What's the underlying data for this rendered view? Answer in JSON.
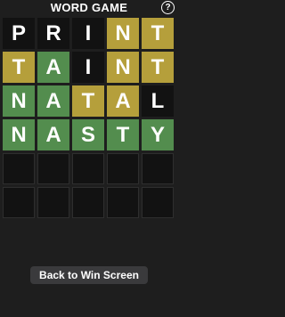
{
  "header": {
    "title": "WORD GAME",
    "help_label": "?"
  },
  "colors": {
    "background": "#1e1e1e",
    "absent": "#121212",
    "present": "#b59f3b",
    "correct": "#538d4e",
    "button": "#3a3a3c"
  },
  "board": {
    "rows": [
      {
        "tiles": [
          {
            "letter": "P",
            "state": "absent"
          },
          {
            "letter": "R",
            "state": "absent"
          },
          {
            "letter": "I",
            "state": "absent"
          },
          {
            "letter": "N",
            "state": "present"
          },
          {
            "letter": "T",
            "state": "present"
          }
        ]
      },
      {
        "tiles": [
          {
            "letter": "T",
            "state": "present"
          },
          {
            "letter": "A",
            "state": "correct"
          },
          {
            "letter": "I",
            "state": "absent"
          },
          {
            "letter": "N",
            "state": "present"
          },
          {
            "letter": "T",
            "state": "present"
          }
        ]
      },
      {
        "tiles": [
          {
            "letter": "N",
            "state": "correct"
          },
          {
            "letter": "A",
            "state": "correct"
          },
          {
            "letter": "T",
            "state": "present"
          },
          {
            "letter": "A",
            "state": "present"
          },
          {
            "letter": "L",
            "state": "absent"
          }
        ]
      },
      {
        "tiles": [
          {
            "letter": "N",
            "state": "correct"
          },
          {
            "letter": "A",
            "state": "correct"
          },
          {
            "letter": "S",
            "state": "correct"
          },
          {
            "letter": "T",
            "state": "correct"
          },
          {
            "letter": "Y",
            "state": "correct"
          }
        ]
      },
      {
        "tiles": [
          {
            "letter": "",
            "state": "empty"
          },
          {
            "letter": "",
            "state": "empty"
          },
          {
            "letter": "",
            "state": "empty"
          },
          {
            "letter": "",
            "state": "empty"
          },
          {
            "letter": "",
            "state": "empty"
          }
        ]
      },
      {
        "tiles": [
          {
            "letter": "",
            "state": "empty"
          },
          {
            "letter": "",
            "state": "empty"
          },
          {
            "letter": "",
            "state": "empty"
          },
          {
            "letter": "",
            "state": "empty"
          },
          {
            "letter": "",
            "state": "empty"
          }
        ]
      }
    ]
  },
  "footer": {
    "back_button_label": "Back to Win Screen"
  }
}
